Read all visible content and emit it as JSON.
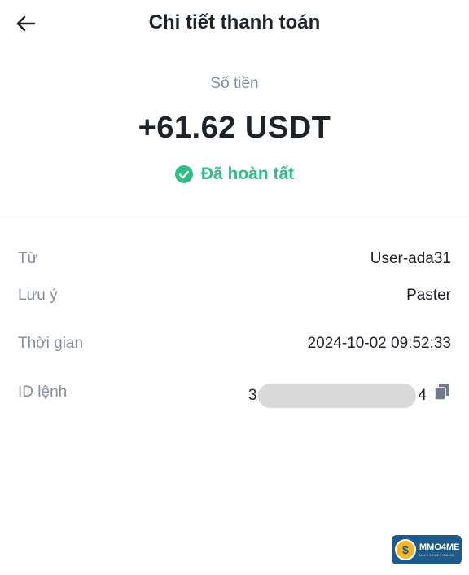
{
  "header": {
    "title": "Chi tiết thanh toán",
    "back_icon": "arrow-left-icon"
  },
  "summary": {
    "amount_label": "Số tiền",
    "amount": "+61.62 USDT",
    "status": "Đã hoàn tất",
    "status_icon": "check-circle-icon",
    "status_color": "#2ebd85"
  },
  "details": {
    "from": {
      "label": "Từ",
      "value": "User-ada31"
    },
    "note": {
      "label": "Lưu ý",
      "value": "Paster"
    },
    "time": {
      "label": "Thời gian",
      "value": "2024-10-02 09:52:33"
    },
    "order_id": {
      "label": "ID lệnh",
      "value_start": "3",
      "value_end": "4",
      "copy_icon": "copy-icon"
    }
  },
  "watermark": {
    "brand": "MMO4ME",
    "tagline": "MAKE MONEY ONLINE",
    "bg_color": "#1e5a8a"
  },
  "colors": {
    "text_primary": "#1e2329",
    "text_secondary": "#848e9c",
    "success": "#2ebd85"
  }
}
